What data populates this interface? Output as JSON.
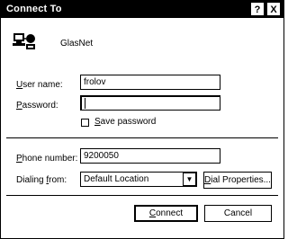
{
  "window": {
    "title": "Connect To",
    "help_button": "?",
    "close_button": "X"
  },
  "connection": {
    "name": "GlasNet",
    "icon": "dialup-connection-icon"
  },
  "form": {
    "user_name_label_accel": "U",
    "user_name_label_rest": "ser name:",
    "user_name_value": "frolov",
    "password_label_accel": "P",
    "password_label_rest": "assword:",
    "password_value": "",
    "save_password_accel": "S",
    "save_password_rest": "ave password",
    "save_password_checked": false,
    "phone_number_label_accel": "P",
    "phone_number_label_rest": "hone number:",
    "phone_number_value": "9200050",
    "dialing_from_label_rest": "Dialing ",
    "dialing_from_label_accel": "f",
    "dialing_from_label_tail": "rom:",
    "dialing_from_value": "Default Location",
    "dial_properties_accel": "D",
    "dial_properties_rest": "ial Properties..."
  },
  "buttons": {
    "connect_accel": "C",
    "connect_rest": "onnect",
    "cancel": "Cancel"
  }
}
